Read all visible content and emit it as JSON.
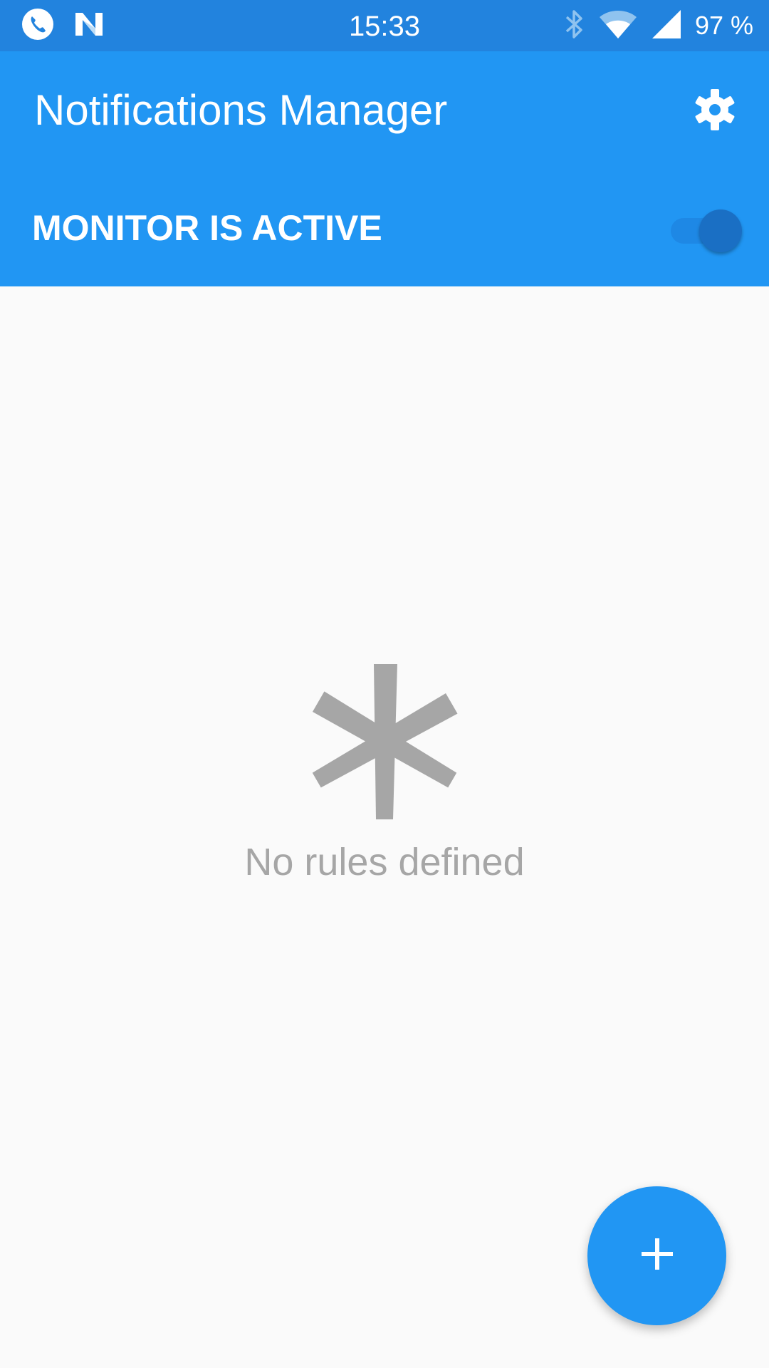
{
  "status_bar": {
    "time": "15:33",
    "battery": "97 %",
    "icons": [
      "phone-call-icon",
      "n-logo-icon",
      "bluetooth-icon",
      "wifi-icon",
      "cell-signal-icon"
    ],
    "background": "#2283de"
  },
  "app_bar": {
    "title": "Notifications Manager",
    "settings_icon": "gear-icon",
    "background": "#2196f3"
  },
  "monitor": {
    "label": "MONITOR IS ACTIVE",
    "enabled": true
  },
  "empty_state": {
    "icon": "asterisk-icon",
    "text": "No rules defined",
    "icon_color": "#a6a6a6"
  },
  "fab": {
    "icon": "plus-icon",
    "color": "#2196f3"
  }
}
